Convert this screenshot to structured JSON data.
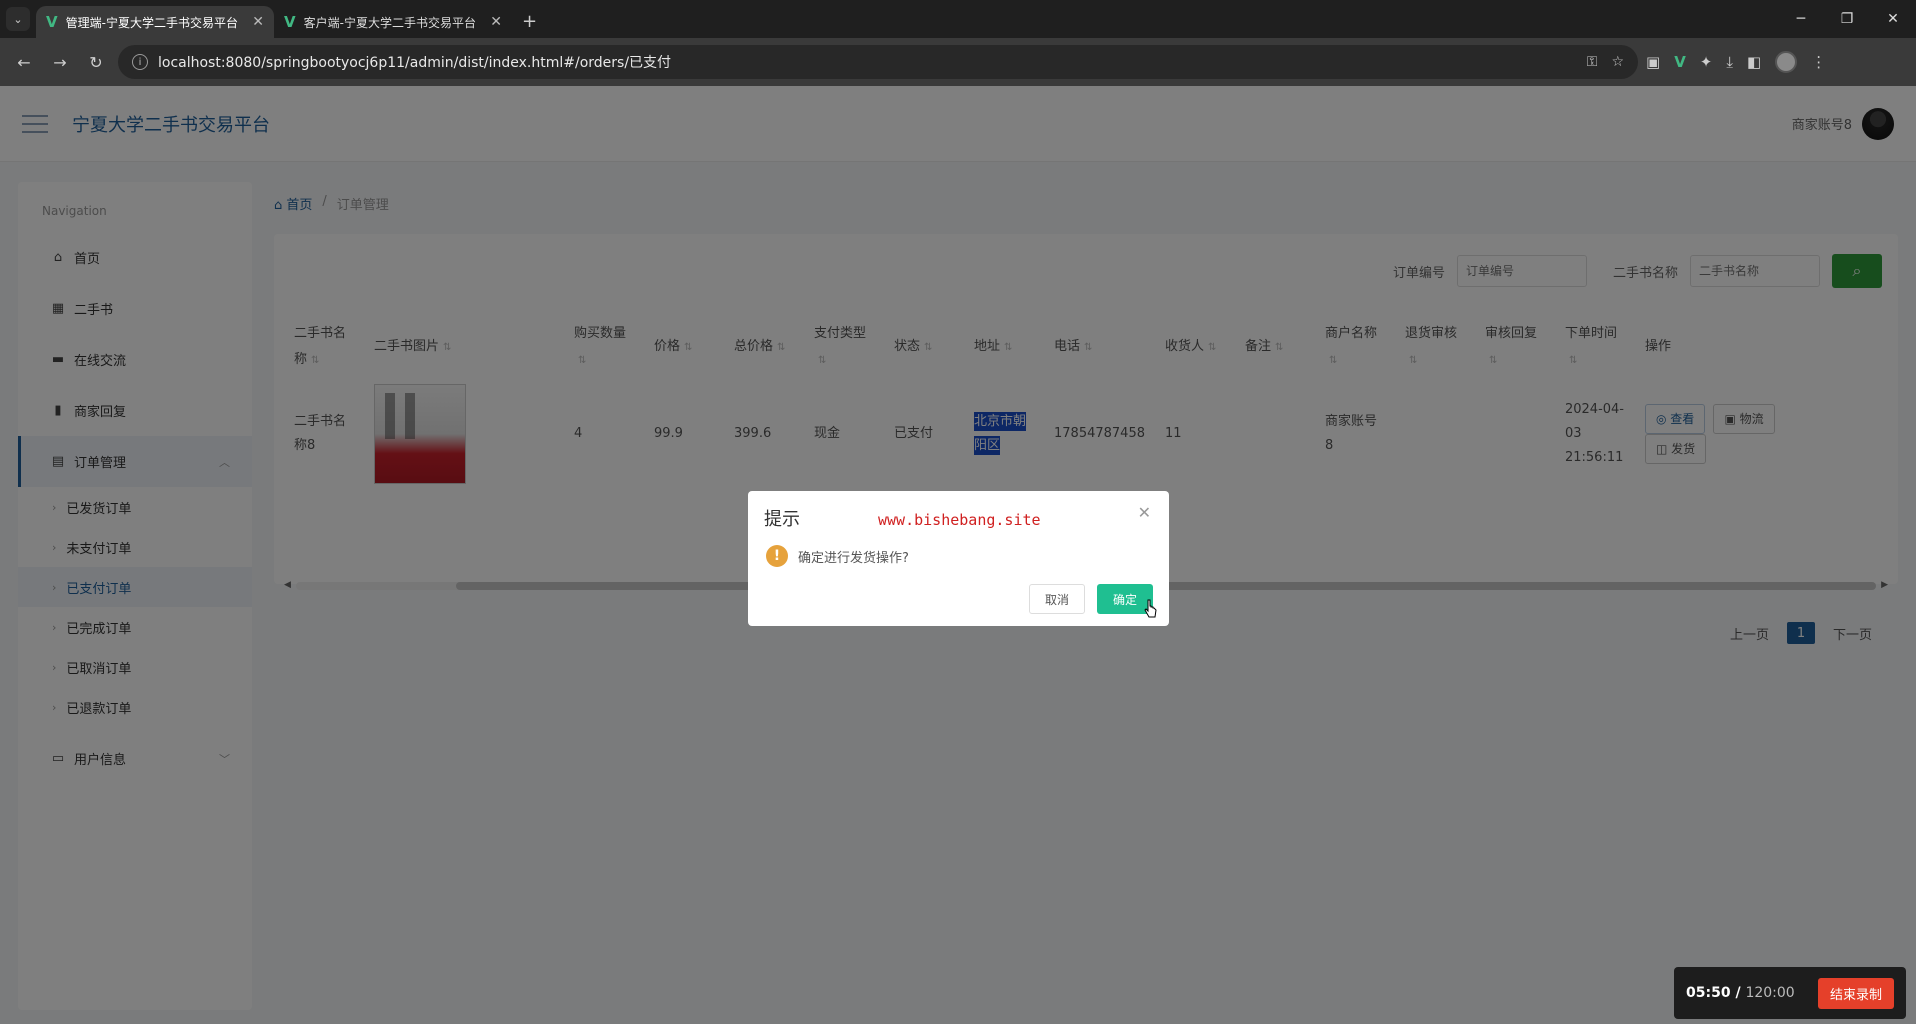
{
  "browser": {
    "tabs": [
      {
        "title": "管理端-宁夏大学二手书交易平台",
        "active": true
      },
      {
        "title": "客户端-宁夏大学二手书交易平台",
        "active": false
      }
    ],
    "new_tab": "+",
    "url": "localhost:8080/springbootyocj6p11/admin/dist/index.html#/orders/已支付"
  },
  "app": {
    "title": "宁夏大学二手书交易平台",
    "user": "商家账号8"
  },
  "sidebar": {
    "heading": "Navigation",
    "items": [
      {
        "label": "首页",
        "icon": "home-icon"
      },
      {
        "label": "二手书",
        "icon": "grid-icon"
      },
      {
        "label": "在线交流",
        "icon": "chat-icon"
      },
      {
        "label": "商家回复",
        "icon": "bar-chart-icon"
      },
      {
        "label": "订单管理",
        "icon": "order-icon"
      }
    ],
    "order_sub": [
      "已发货订单",
      "未支付订单",
      "已支付订单",
      "已完成订单",
      "已取消订单",
      "已退款订单"
    ],
    "user_info": "用户信息"
  },
  "breadcrumb": {
    "home": "首页",
    "current": "订单管理"
  },
  "search": {
    "order_label": "订单编号",
    "order_placeholder": "订单编号",
    "book_label": "二手书名称",
    "book_placeholder": "二手书名称"
  },
  "table": {
    "headers": [
      "二手书名称",
      "二手书图片",
      "购买数量",
      "价格",
      "总价格",
      "支付类型",
      "状态",
      "地址",
      "电话",
      "收货人",
      "备注",
      "商户名称",
      "退货审核",
      "审核回复",
      "下单时间",
      "操作"
    ],
    "row": {
      "name": "二手书名称8",
      "qty": "4",
      "price": "99.9",
      "total": "399.6",
      "pay_type": "现金",
      "status": "已支付",
      "address": "北京市朝阳区",
      "phone": "17854787458",
      "receiver": "11",
      "merchant": "商家账号8",
      "order_time": "2024-04-03 21:56:11"
    },
    "actions": [
      "查看",
      "物流",
      "发货"
    ]
  },
  "pager": {
    "prev": "上一页",
    "page": "1",
    "next": "下一页"
  },
  "dialog": {
    "title": "提示",
    "watermark": "www.bishebang.site",
    "message": "确定进行发货操作?",
    "cancel": "取消",
    "confirm": "确定"
  },
  "recorder": {
    "elapsed": "05:50",
    "total": "120:00",
    "stop": "结束录制"
  }
}
